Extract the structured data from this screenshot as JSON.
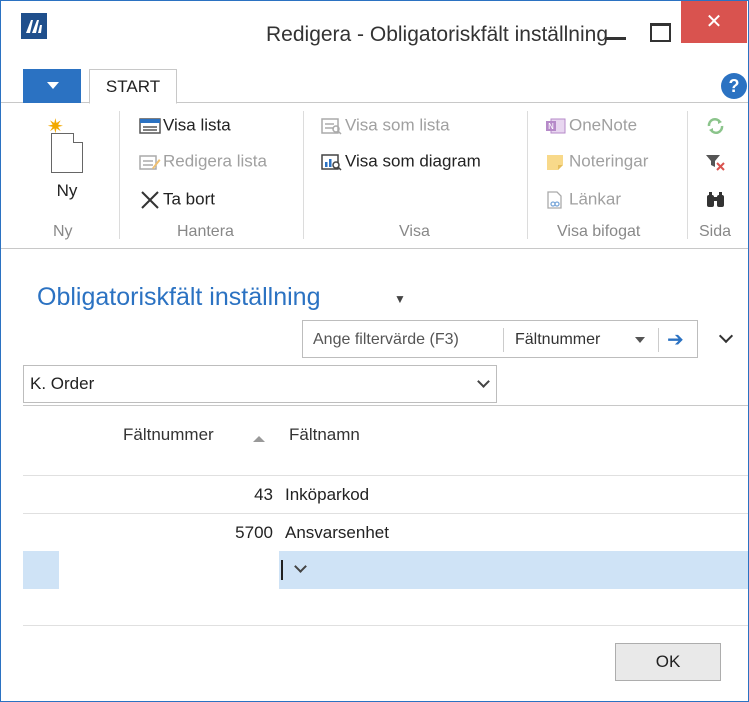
{
  "window": {
    "title": "Redigera - Obligatoriskfält inställning",
    "close_label": "✕"
  },
  "ribbon": {
    "tab_start": "START",
    "help_label": "?",
    "groups": {
      "ny": {
        "label": "Ny",
        "button": "Ny"
      },
      "hantera": {
        "label": "Hantera",
        "visa_lista": "Visa lista",
        "redigera_lista": "Redigera lista",
        "ta_bort": "Ta bort"
      },
      "visa": {
        "label": "Visa",
        "visa_som_lista": "Visa som lista",
        "visa_som_diagram": "Visa som diagram"
      },
      "visa_bifogat": {
        "label": "Visa bifogat",
        "onenote": "OneNote",
        "noteringar": "Noteringar",
        "lankar": "Länkar"
      },
      "sida": {
        "label": "Sida"
      }
    }
  },
  "page": {
    "title": "Obligatoriskfält inställning",
    "filter": {
      "placeholder": "Ange filtervärde (F3)",
      "field": "Fältnummer"
    },
    "view_value": "K. Order"
  },
  "grid": {
    "columns": [
      "Fältnummer",
      "Fältnamn"
    ],
    "rows": [
      {
        "faltnummer": "43",
        "faltnamn": "Inköparkod"
      },
      {
        "faltnummer": "5700",
        "faltnamn": "Ansvarsenhet"
      }
    ]
  },
  "footer": {
    "ok_label": "OK"
  },
  "colors": {
    "accent": "#2b72c2",
    "close": "#d9534f",
    "selection": "#cfe3f6"
  }
}
